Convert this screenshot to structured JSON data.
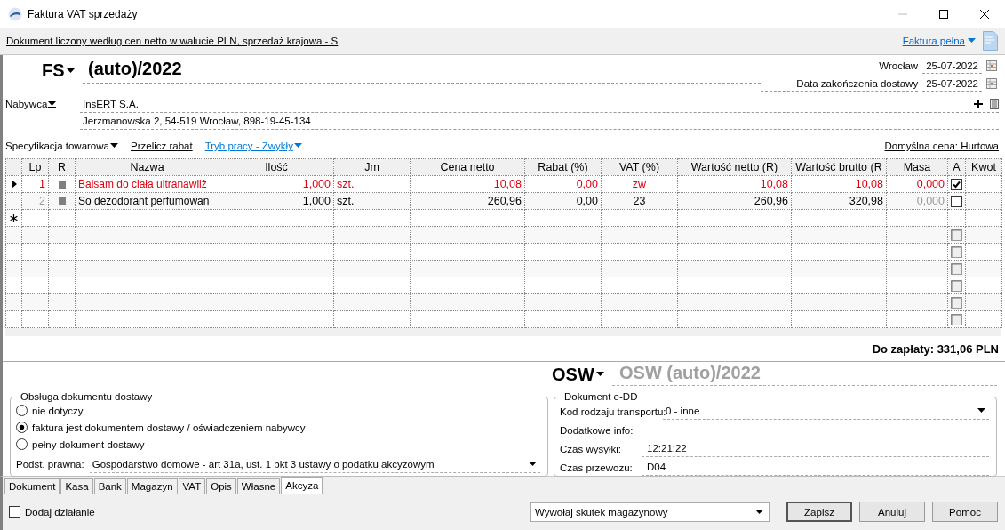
{
  "window": {
    "title": "Faktura VAT sprzedaży"
  },
  "info_bar": {
    "text": "Dokument liczony według cen netto w walucie PLN, sprzedaż krajowa - S",
    "invoice_type": "Faktura pełna"
  },
  "document": {
    "prefix": "FS",
    "number": "(auto)/2022",
    "place": "Wrocław",
    "date": "25-07-2022",
    "delivery_date_label": "Data zakończenia dostawy",
    "delivery_date": "25-07-2022"
  },
  "buyer": {
    "label": "Nabywca",
    "name": "InsERT S.A.",
    "address": "Jerzmanowska 2, 54-519 Wrocław, 898-19-45-134"
  },
  "grid_toolbar": {
    "specification": "Specyfikacja towarowa",
    "recalculate": "Przelicz rabat",
    "work_mode": "Tryb pracy - Zwykły",
    "default_price": "Domyślna cena: Hurtowa"
  },
  "table": {
    "columns": [
      "Lp",
      "R",
      "Nazwa",
      "Ilość",
      "Jm",
      "Cena netto",
      "Rabat (%)",
      "VAT (%)",
      "Wartość netto (R)",
      "Wartość brutto (R",
      "Masa",
      "A",
      "Kwot"
    ],
    "rows": [
      {
        "kind": "item",
        "selected": true,
        "highlighted": true,
        "lp": "1",
        "name": "Balsam do ciała ultranawilż",
        "qty": "1,000",
        "unit": "szt.",
        "net_price": "10,08",
        "discount": "0,00",
        "vat": "zw",
        "net_value": "10,08",
        "gross_value": "10,08",
        "mass": "0,000",
        "checked": true
      },
      {
        "kind": "item",
        "selected": false,
        "highlighted": false,
        "lp": "2",
        "name": "So dezodorant perfumowan",
        "qty": "1,000",
        "unit": "szt.",
        "net_price": "260,96",
        "discount": "0,00",
        "vat": "23",
        "net_value": "260,96",
        "gross_value": "320,98",
        "mass": "0,000",
        "checked": false
      },
      {
        "kind": "new"
      },
      {
        "kind": "empty",
        "checked": false
      },
      {
        "kind": "empty",
        "checked": false
      },
      {
        "kind": "empty",
        "checked": false
      },
      {
        "kind": "empty",
        "checked": false
      },
      {
        "kind": "empty",
        "checked": false
      },
      {
        "kind": "empty",
        "checked": false
      }
    ]
  },
  "total": "Do zapłaty: 331,06 PLN",
  "excise_document": {
    "prefix": "OSW",
    "number": "OSW (auto)/2022"
  },
  "delivery_handling": {
    "title": "Obsługa dokumentu dostawy",
    "options": [
      {
        "label": "nie dotyczy",
        "selected": false
      },
      {
        "label": "faktura jest dokumentem dostawy / oświadczeniem nabywcy",
        "selected": true
      },
      {
        "label": "pełny dokument dostawy",
        "selected": false
      }
    ],
    "legal_basis_label": "Podst. prawna:",
    "legal_basis": "Gospodarstwo domowe - art 31a, ust. 1 pkt 3 ustawy o podatku akcyzowym"
  },
  "edd": {
    "title": "Dokument e-DD",
    "fields": [
      {
        "kind": "dropdown",
        "label": "Kod rodzaju transportu:",
        "value": "0 - inne"
      },
      {
        "kind": "text",
        "label": "Dodatkowe info:"
      },
      {
        "kind": "text",
        "label": "Czas wysyłki:",
        "value": "12:21:22"
      },
      {
        "kind": "text",
        "label": "Czas przewozu:",
        "value": "D04"
      }
    ]
  },
  "tabs": [
    {
      "label": "Dokument",
      "selected": false
    },
    {
      "label": "Kasa",
      "selected": false
    },
    {
      "label": "Bank",
      "selected": false
    },
    {
      "label": "Magazyn",
      "selected": false
    },
    {
      "label": "VAT",
      "selected": false
    },
    {
      "label": "Opis",
      "selected": false
    },
    {
      "label": "Własne",
      "selected": false
    },
    {
      "label": "Akcyza",
      "selected": true
    }
  ],
  "footer": {
    "add_action": {
      "label": "Dodaj działanie",
      "checked": false
    },
    "warehouse_effect": "Wywołaj skutek magazynowy",
    "buttons": [
      "Zapisz",
      "Anuluj",
      "Pomoc"
    ]
  }
}
